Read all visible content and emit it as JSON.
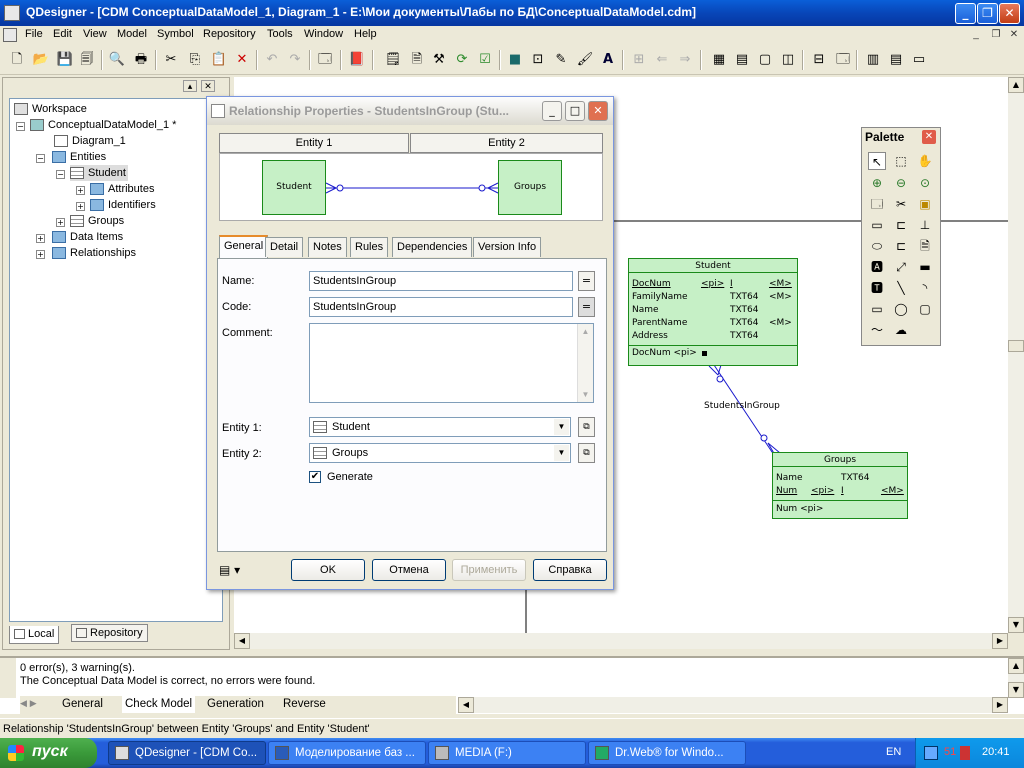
{
  "window": {
    "title": "QDesigner - [CDM ConceptualDataModel_1, Diagram_1 - E:\\Мои документы\\Лабы по БД\\ConceptualDataModel.cdm]"
  },
  "menu": [
    "File",
    "Edit",
    "View",
    "Model",
    "Symbol",
    "Repository",
    "Tools",
    "Window",
    "Help"
  ],
  "tree": {
    "workspace": "Workspace",
    "model": "ConceptualDataModel_1 *",
    "diagram": "Diagram_1",
    "entities": "Entities",
    "student": "Student",
    "attributes": "Attributes",
    "identifiers": "Identifiers",
    "groups": "Groups",
    "data_items": "Data Items",
    "relationships": "Relationships"
  },
  "left_tabs": {
    "local": "Local",
    "repository": "Repository"
  },
  "dialog": {
    "title": "Relationship Properties - StudentsInGroup (Stu...",
    "entity1_header": "Entity 1",
    "entity2_header": "Entity 2",
    "preview_left": "Student",
    "preview_right": "Groups",
    "tabs": [
      "General",
      "Detail",
      "Notes",
      "Rules",
      "Dependencies",
      "Version Info"
    ],
    "name_label": "Name:",
    "name_value": "StudentsInGroup",
    "code_label": "Code:",
    "code_value": "StudentsInGroup",
    "comment_label": "Comment:",
    "entity1_label": "Entity 1:",
    "entity1_value": "Student",
    "entity2_label": "Entity 2:",
    "entity2_value": "Groups",
    "generate_label": "Generate",
    "generate_checked": true,
    "eq": "=",
    "buttons": {
      "ok": "OK",
      "cancel": "Отмена",
      "apply": "Применить",
      "help": "Справка"
    }
  },
  "palette": {
    "title": "Palette"
  },
  "diagram": {
    "student": {
      "title": "Student",
      "rows": [
        {
          "name": "DocNum",
          "type": "<pi>",
          "flag": "I",
          "m": "<M>"
        },
        {
          "name": "FamilyName",
          "type": "TXT64",
          "flag": "",
          "m": "<M>"
        },
        {
          "name": "Name",
          "type": "TXT64",
          "flag": "",
          "m": ""
        },
        {
          "name": "ParentName",
          "type": "TXT64",
          "flag": "",
          "m": "<M>"
        },
        {
          "name": "Address",
          "type": "TXT64",
          "flag": "",
          "m": ""
        }
      ],
      "identifier": "DocNum  <pi>"
    },
    "relationship_label": "StudentsInGroup",
    "groups": {
      "title": "Groups",
      "rows": [
        {
          "name": "Name",
          "type": "TXT64",
          "flag": "",
          "m": ""
        },
        {
          "name": "Num",
          "type": "<pi>",
          "flag": "I",
          "m": "<M>"
        }
      ],
      "identifier": "Num  <pi>"
    }
  },
  "output": {
    "line1": "0 error(s), 3 warning(s).",
    "line2": "The Conceptual Data Model is correct, no errors were found.",
    "tabs": [
      "General",
      "Check Model",
      "Generation",
      "Reverse"
    ]
  },
  "status": "Relationship 'StudentsInGroup' between Entity 'Groups' and Entity 'Student'",
  "taskbar": {
    "start": "пуск",
    "tasks": [
      "QDesigner - [CDM Co...",
      "Моделирование баз ...",
      "MEDIA (F:)",
      "Dr.Web® for Windo..."
    ],
    "lang": "EN",
    "tray_num": "51",
    "clock": "20:41"
  }
}
